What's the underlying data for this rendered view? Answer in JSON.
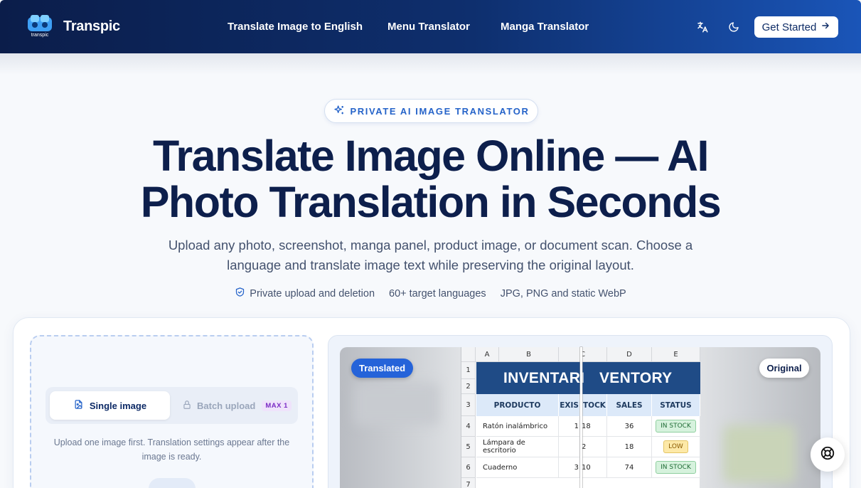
{
  "nav": {
    "brand": "Transpic",
    "logo_text": "transpic",
    "links": [
      "Translate Image to English",
      "Menu Translator",
      "Manga Translator"
    ],
    "cta_label": "Get Started",
    "icons": [
      "translate-icon",
      "moon-icon",
      "arrow-right-icon"
    ]
  },
  "hero": {
    "badge": "PRIVATE AI IMAGE TRANSLATOR",
    "title": "Translate Image Online — AI Photo Translation in Seconds",
    "subtitle": "Upload any photo, screenshot, manga panel, product image, or document scan. Choose a language and translate image text while preserving the original layout.",
    "features": [
      "Private upload and deletion",
      "60+ target languages",
      "JPG, PNG and static WebP"
    ]
  },
  "upload": {
    "tab_single": "Single image",
    "tab_batch": "Batch upload",
    "batch_badge": "MAX 1",
    "hint": "Upload one image first. Translation settings appear after the image is ready."
  },
  "preview": {
    "label_translated": "Translated",
    "label_original": "Original",
    "sheet": {
      "columns": [
        "A",
        "B",
        "C",
        "D",
        "E"
      ],
      "rows": [
        "1",
        "2",
        "3",
        "4",
        "5",
        "6",
        "7"
      ],
      "title_left": "INVENTARI",
      "title_right": "VENTORY",
      "headers": [
        "PRODUCTO",
        "EXIS",
        "TOCK",
        "SALES",
        "STATUS"
      ],
      "data": [
        {
          "product": "Ratón inalámbrico",
          "stock_l": "1",
          "stock_r": "18",
          "sales": "36",
          "status": "IN STOCK"
        },
        {
          "product": "Lámpara de escritorio",
          "stock_l": "",
          "stock_r": "2",
          "sales": "18",
          "status": "LOW"
        },
        {
          "product": "Cuaderno",
          "stock_l": "3",
          "stock_r": "10",
          "sales": "74",
          "status": "IN STOCK"
        }
      ]
    }
  },
  "colors": {
    "nav_start": "#0b1d4a",
    "nav_end": "#1a55b8",
    "accent": "#2563d9",
    "heading": "#0d1f4c",
    "sheet_title": "#1f4b86"
  }
}
